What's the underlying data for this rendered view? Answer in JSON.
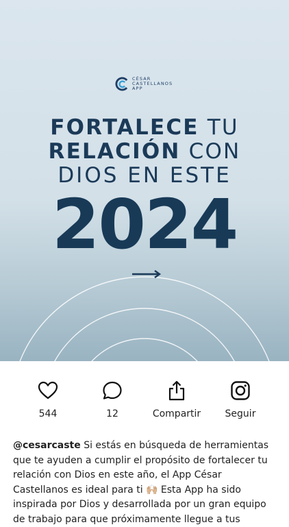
{
  "post": {
    "logo": {
      "line1": "CÉSAR",
      "line2": "CASTELLANOS",
      "line3": "APP"
    },
    "headline": {
      "line1_bold": "FORTALECE",
      "line1_thin": "TU",
      "line2_bold": "RELACIÓN",
      "line2_thin": "CON",
      "line3": "DIOS EN ESTE"
    },
    "year": "2024",
    "colors": {
      "text_dark": "#1b3a58",
      "logo_blue": "#1f3f66",
      "logo_light": "#3aa0d8"
    }
  },
  "actions": {
    "like": {
      "icon": "heart-icon",
      "label": "544"
    },
    "comment": {
      "icon": "comment-icon",
      "label": "12"
    },
    "share": {
      "icon": "share-icon",
      "label": "Compartir"
    },
    "follow": {
      "icon": "instagram-icon",
      "label": "Seguir"
    }
  },
  "caption": {
    "username": "@cesarcaste",
    "text": "Si estás en búsqueda de herramientas que te ayuden a cumplir el propósito de fortalecer tu relación con Dios en este año, el App César Castellanos es ideal para ti 🙌🏼  Esta App ha sido inspirada por Dios y desarrollada por un gran equipo de trabajo para que próximamente llegue a tus"
  }
}
